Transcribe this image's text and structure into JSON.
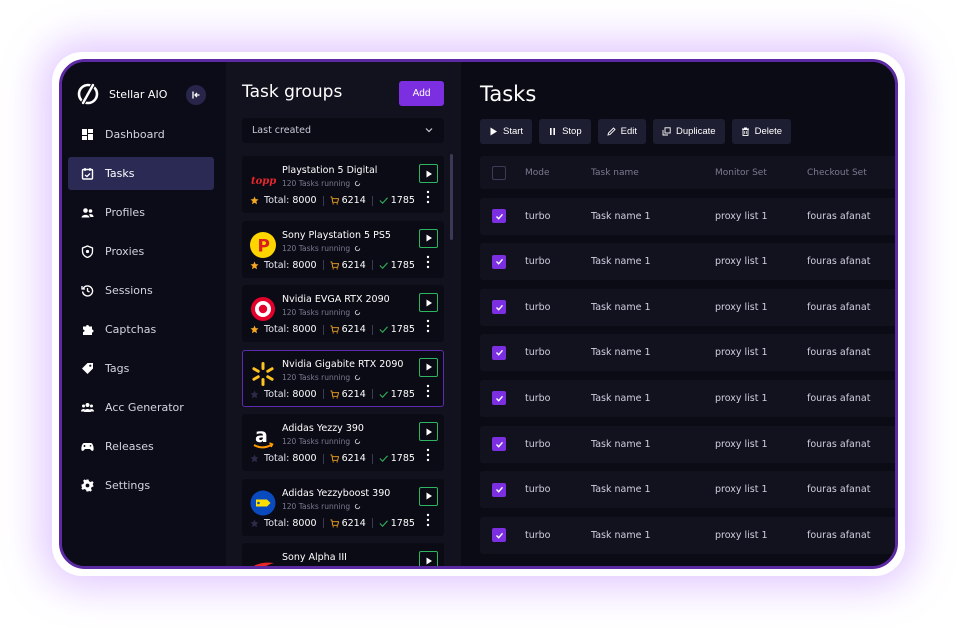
{
  "brand": {
    "name": "Stellar AIO",
    "accent": "#7b2fe0"
  },
  "nav": [
    {
      "label": "Dashboard",
      "icon": "dashboard-icon",
      "active": false
    },
    {
      "label": "Tasks",
      "icon": "tasks-icon",
      "active": true
    },
    {
      "label": "Profiles",
      "icon": "profiles-icon",
      "active": false
    },
    {
      "label": "Proxies",
      "icon": "proxies-icon",
      "active": false
    },
    {
      "label": "Sessions",
      "icon": "sessions-icon",
      "active": false
    },
    {
      "label": "Captchas",
      "icon": "captchas-icon",
      "active": false
    },
    {
      "label": "Tags",
      "icon": "tags-icon",
      "active": false
    },
    {
      "label": "Acc Generator",
      "icon": "acc-generator-icon",
      "active": false
    },
    {
      "label": "Releases",
      "icon": "releases-icon",
      "active": false
    },
    {
      "label": "Settings",
      "icon": "settings-icon",
      "active": false
    }
  ],
  "groups": {
    "title": "Task groups",
    "add_label": "Add",
    "sort_value": "Last created",
    "total_label": "Total:",
    "items": [
      {
        "name": "Playstation 5 Digital",
        "logo": "topps-logo",
        "sub": "120 Tasks running",
        "total": "8000",
        "carted": "6214",
        "checked": "1785",
        "starred": true
      },
      {
        "name": "Sony Playstation 5 PS5",
        "logo": "parking-logo",
        "sub": "120 Tasks running",
        "total": "8000",
        "carted": "6214",
        "checked": "1785",
        "starred": true
      },
      {
        "name": "Nvidia EVGA RTX 2090",
        "logo": "target-logo",
        "sub": "120 Tasks running",
        "total": "8000",
        "carted": "6214",
        "checked": "1785",
        "starred": true
      },
      {
        "name": "Nvidia Gigabite RTX 2090",
        "logo": "walmart-logo",
        "sub": "120 Tasks running",
        "total": "8000",
        "carted": "6214",
        "checked": "1785",
        "starred": false
      },
      {
        "name": "Adidas Yezzy 390",
        "logo": "amazon-logo",
        "sub": "120 Tasks running",
        "total": "8000",
        "carted": "6214",
        "checked": "1785",
        "starred": false
      },
      {
        "name": "Adidas Yezzyboost 390",
        "logo": "bestbuy-logo",
        "sub": "120 Tasks running",
        "total": "8000",
        "carted": "6214",
        "checked": "1785",
        "starred": false
      },
      {
        "name": "Sony Alpha III",
        "logo": "swoosh-logo",
        "sub": "",
        "total": "",
        "carted": "",
        "checked": "",
        "starred": false
      }
    ]
  },
  "tasks": {
    "title": "Tasks",
    "toolbar": {
      "start": "Start",
      "stop": "Stop",
      "edit": "Edit",
      "duplicate": "Duplicate",
      "delete": "Delete"
    },
    "columns": {
      "mode": "Mode",
      "name": "Task name",
      "monitor": "Monitor Set",
      "checkout": "Checkout Set"
    },
    "rows": [
      {
        "mode": "turbo",
        "name": "Task name 1",
        "monitor": "proxy list 1",
        "checkout": "fouras afanat"
      },
      {
        "mode": "turbo",
        "name": "Task name 1",
        "monitor": "proxy list 1",
        "checkout": "fouras afanat"
      },
      {
        "mode": "turbo",
        "name": "Task name 1",
        "monitor": "proxy list 1",
        "checkout": "fouras afanat"
      },
      {
        "mode": "turbo",
        "name": "Task name 1",
        "monitor": "proxy list 1",
        "checkout": "fouras afanat"
      },
      {
        "mode": "turbo",
        "name": "Task name 1",
        "monitor": "proxy list 1",
        "checkout": "fouras afanat"
      },
      {
        "mode": "turbo",
        "name": "Task name 1",
        "monitor": "proxy list 1",
        "checkout": "fouras afanat"
      },
      {
        "mode": "turbo",
        "name": "Task name 1",
        "monitor": "proxy list 1",
        "checkout": "fouras afanat"
      },
      {
        "mode": "turbo",
        "name": "Task name 1",
        "monitor": "proxy list 1",
        "checkout": "fouras afanat"
      }
    ]
  }
}
